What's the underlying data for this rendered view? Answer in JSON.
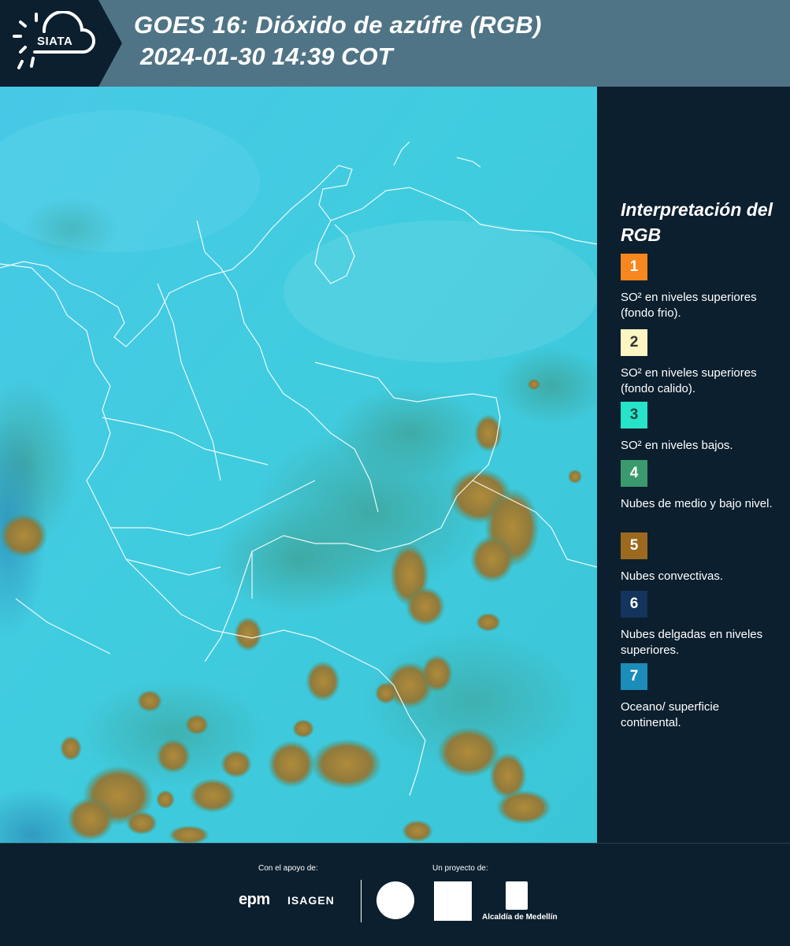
{
  "header": {
    "title_line1": "GOES 16: Dióxido de azúfre (RGB)",
    "title_line2": "2024-01-30 14:39 COT",
    "logo_text": "SIATA"
  },
  "legend": {
    "title": "Interpretación del RGB",
    "items": [
      {
        "number": "1",
        "label": "SO² en niveles superiores (fondo frio).",
        "color": "#f7871e",
        "text_color": "#ffffff"
      },
      {
        "number": "2",
        "label": "SO² en niveles superiores (fondo calido).",
        "color": "#fdf5c2",
        "text_color": "#333333"
      },
      {
        "number": "3",
        "label": "SO² en niveles bajos.",
        "color": "#27e3c8",
        "text_color": "#1a4a44"
      },
      {
        "number": "4",
        "label": "Nubes de medio y bajo nivel.",
        "color": "#3a9a6e",
        "text_color": "#ffffff"
      },
      {
        "number": "5",
        "label": "Nubes convectivas.",
        "color": "#9b6a1e",
        "text_color": "#ffffff"
      },
      {
        "number": "6",
        "label": "Nubes delgadas en niveles superiores.",
        "color": "#13345c",
        "text_color": "#ffffff"
      },
      {
        "number": "7",
        "label": "Oceano/ superficie continental.",
        "color": "#1c8cb9",
        "text_color": "#ffffff"
      }
    ]
  },
  "footer": {
    "support_label": "Con el apoyo de:",
    "project_label": "Un proyecto de:",
    "sponsor1": "epm",
    "sponsor2": "ISAGEN",
    "partner_alcaldia": "Alcaldía de Medellín"
  },
  "colors": {
    "background": "#0c1f2e",
    "header_bar": "#4f7486",
    "ocean_cyan": "#3fc8e4",
    "convective": "#a07a30"
  }
}
